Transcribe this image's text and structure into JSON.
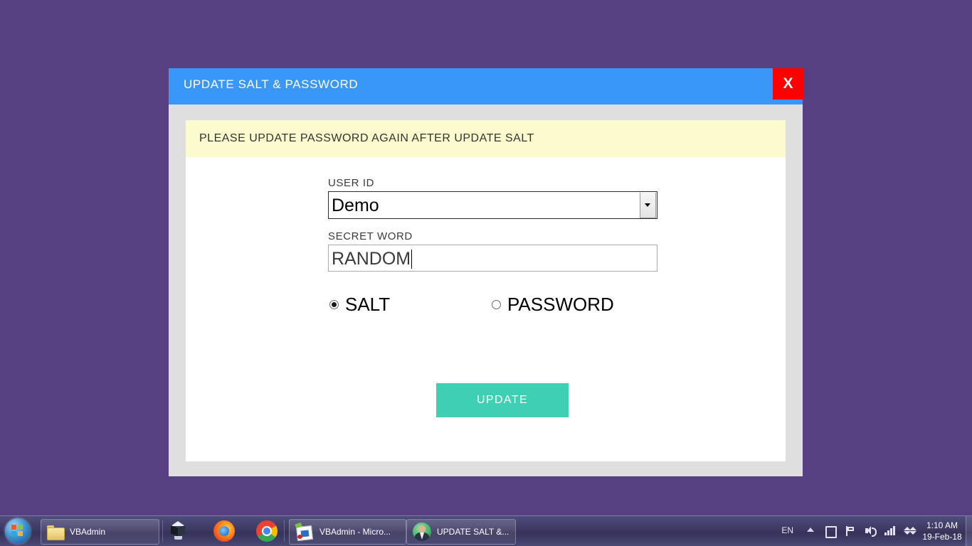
{
  "desktop": {
    "background_color": "#574081"
  },
  "dialog": {
    "title": "UPDATE SALT & PASSWORD",
    "title_bar_color": "#3897f7",
    "close_label": "X",
    "close_color": "#ff0000",
    "notice": "PLEASE UPDATE PASSWORD AGAIN AFTER UPDATE SALT",
    "notice_color": "#fcfbcd",
    "fields": {
      "user_id": {
        "label": "USER ID",
        "value": "Demo",
        "options": [
          "Demo"
        ]
      },
      "secret_word": {
        "label": "SECRET WORD",
        "value": "RANDOM",
        "placeholder": ""
      }
    },
    "radios": [
      {
        "label": "SALT",
        "checked": true
      },
      {
        "label": "PASSWORD",
        "checked": false
      }
    ],
    "update_button": {
      "label": "UPDATE",
      "color": "#3fd0b4"
    }
  },
  "taskbar": {
    "start_icon": "windows-orb-icon",
    "buttons": [
      {
        "label": "VBAdmin",
        "icon": "folder-icon"
      },
      {
        "label": "VBAdmin - Micro...",
        "icon": "access-icon"
      },
      {
        "label": "UPDATE SALT &...",
        "icon": "user-avatar-icon"
      }
    ],
    "quick_launch": [
      {
        "icon": "virtualbox-icon"
      },
      {
        "icon": "firefox-icon"
      },
      {
        "icon": "chrome-icon"
      }
    ],
    "tray": {
      "language": "EN",
      "chevron": "show-hidden-icons-chevron-icon",
      "icons": [
        "action-center-icon",
        "flag-icon",
        "volume-icon",
        "network-icon",
        "dropbox-icon"
      ],
      "time": "1:10 AM",
      "date": "19-Feb-18"
    }
  }
}
